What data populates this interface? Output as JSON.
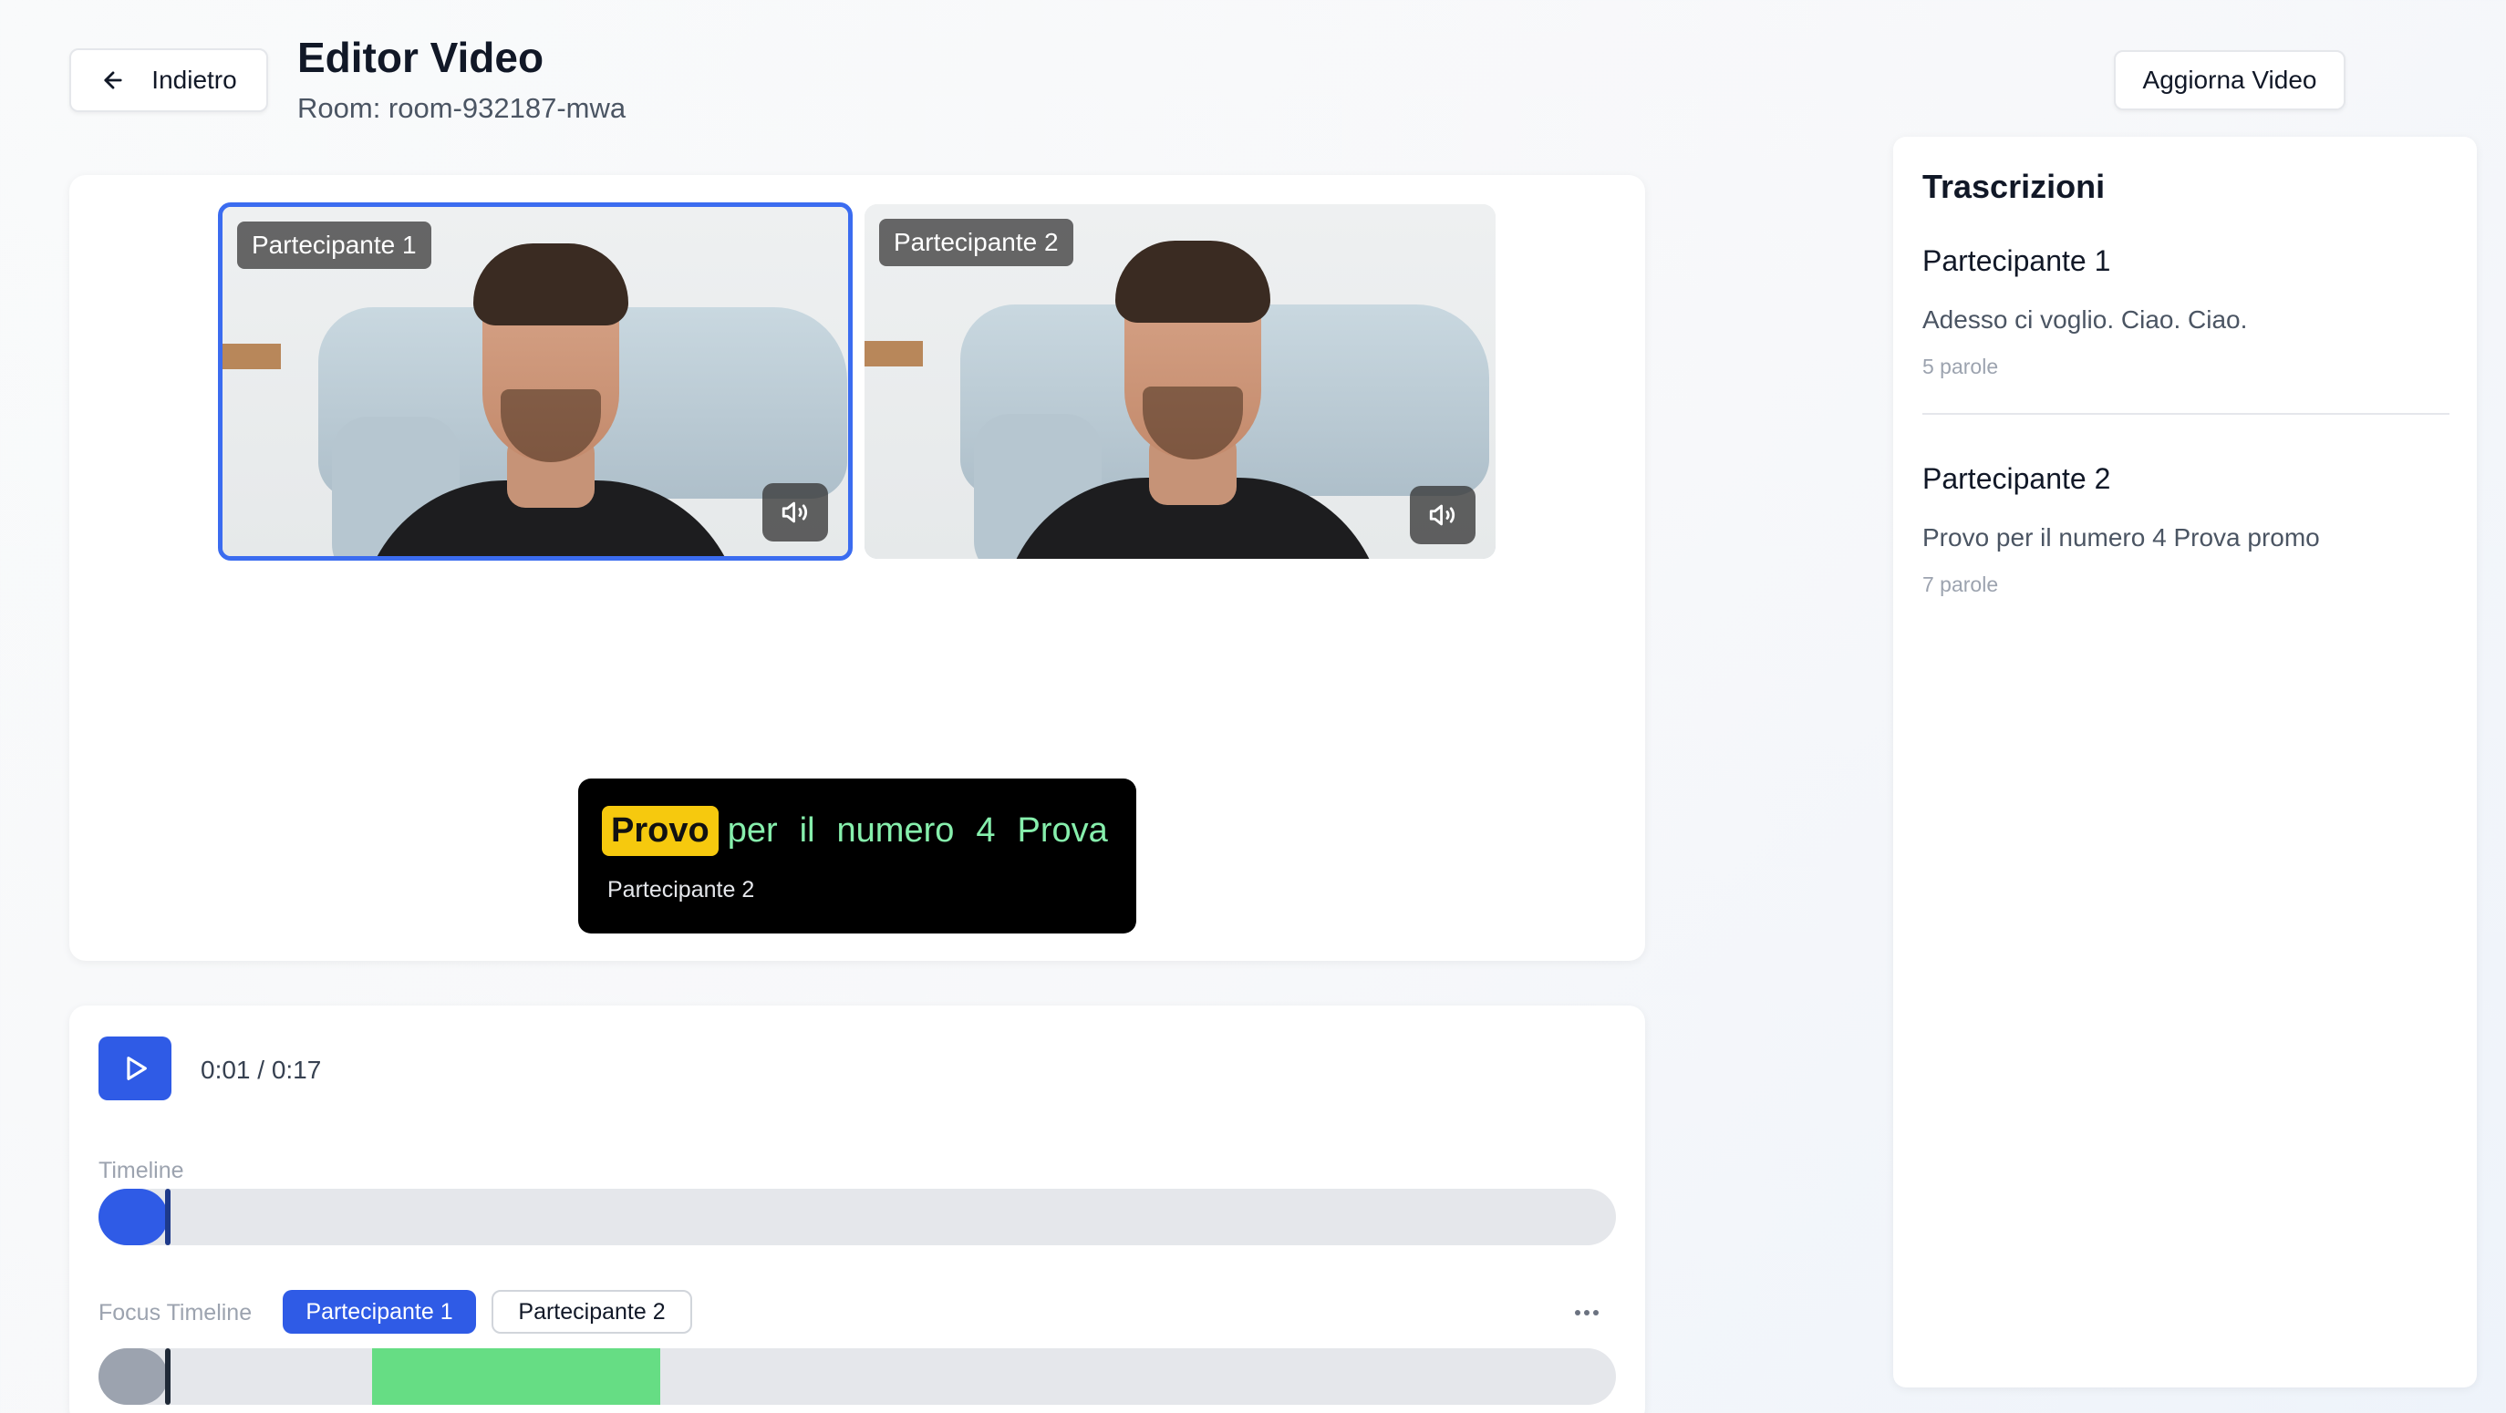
{
  "header": {
    "back_label": "Indietro",
    "title": "Editor Video",
    "subtitle": "Room: room-932187-mwa",
    "update_label": "Aggiorna Video"
  },
  "participants": [
    {
      "label": "Partecipante 1",
      "selected": true
    },
    {
      "label": "Partecipante 2",
      "selected": false
    }
  ],
  "caption": {
    "words": [
      "Provo",
      "per",
      "il",
      "numero",
      "4",
      "Prova"
    ],
    "highlighted_index": 0,
    "speaker": "Partecipante 2"
  },
  "player": {
    "time": "0:01 / 0:17",
    "timeline_label": "Timeline",
    "timeline_progress_fraction": 0.045,
    "focus_label": "Focus Timeline",
    "focus_tabs": [
      {
        "label": "Partecipante 1",
        "active": true
      },
      {
        "label": "Partecipante 2",
        "active": false
      }
    ],
    "focus_segment": {
      "start_fraction": 0.18,
      "end_fraction": 0.37,
      "color": "#66dd84"
    },
    "more_icon": "more-horizontal-icon"
  },
  "transcripts": {
    "title": "Trascrizioni",
    "items": [
      {
        "speaker": "Partecipante 1",
        "text": "Adesso ci voglio. Ciao. Ciao.",
        "words": "5 parole"
      },
      {
        "speaker": "Partecipante 2",
        "text": "Provo per il numero 4 Prova promo",
        "words": "7 parole"
      }
    ]
  },
  "colors": {
    "accent": "#2f5be6",
    "highlight": "#f6c90e",
    "caption_word": "#86efac"
  }
}
